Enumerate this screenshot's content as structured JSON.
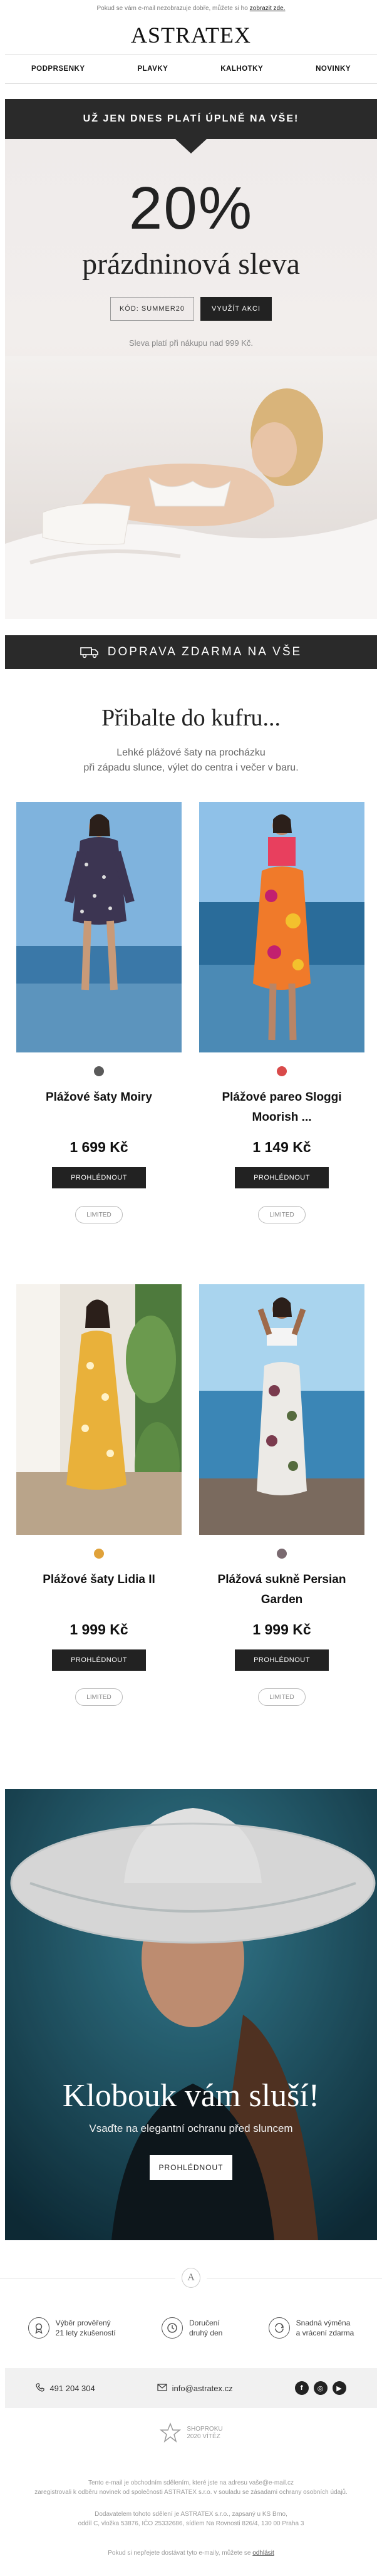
{
  "preheader": {
    "text": "Pokud se vám e-mail nezobrazuje dobře, můžete si ho",
    "link": "zobrazit zde."
  },
  "brand": {
    "logo": "ASTRATEX"
  },
  "nav": {
    "items": [
      "PODPRSENKY",
      "PLAVKY",
      "KALHOTKY",
      "NOVINKY"
    ]
  },
  "hero": {
    "bar": "UŽ JEN DNES PLATÍ ÚPLNĚ NA VŠE!",
    "percent": "20%",
    "subtitle": "prázdninová sleva",
    "code": "KÓD: SUMMER20",
    "cta": "VYUŽÍT AKCI",
    "note": "Sleva platí při nákupu nad 999 Kč."
  },
  "shipping": {
    "text": "DOPRAVA ZDARMA NA VŠE",
    "icon": "truck-icon"
  },
  "section": {
    "title": "Přibalte do kufru...",
    "line1": "Lehké plážové šaty na procházku",
    "line2": "při západu slunce, výlet do centra i večer v baru."
  },
  "products": [
    {
      "name": "Plážové šaty Moiry",
      "price": "1 699 Kč",
      "button": "PROHLÉDNOUT",
      "badge": "LIMITED",
      "dot_color": "#5a5a5a"
    },
    {
      "name": "Plážové pareo Sloggi Moorish ...",
      "price": "1 149 Kč",
      "button": "PROHLÉDNOUT",
      "badge": "LIMITED",
      "dot_color": "#d94a4a"
    },
    {
      "name": "Plážové šaty Lidia II",
      "price": "1 999 Kč",
      "button": "PROHLÉDNOUT",
      "badge": "LIMITED",
      "dot_color": "#e0a23a"
    },
    {
      "name": "Plážová sukně Persian Garden",
      "price": "1 999 Kč",
      "button": "PROHLÉDNOUT",
      "badge": "LIMITED",
      "dot_color": "#7a6a70"
    }
  ],
  "hat": {
    "title": "Klobouk vám sluší!",
    "subtitle": "Vsaďte na elegantní ochranu před sluncem",
    "button": "PROHLÉDNOUT"
  },
  "seal": {
    "letter": "A"
  },
  "benefits": [
    {
      "line1": "Výběr prověřený",
      "line2": "21 lety zkušeností",
      "icon": "award-icon"
    },
    {
      "line1": "Doručení",
      "line2": "druhý den",
      "icon": "clock-icon"
    },
    {
      "line1": "Snadná výměna",
      "line2": "a vrácení zdarma",
      "icon": "return-icon"
    }
  ],
  "contact": {
    "phone": "491 204 304",
    "email": "info@astratex.cz",
    "social": [
      "f",
      "◎",
      "▶"
    ]
  },
  "award": {
    "line1": "SHOPROKU",
    "line2": "2020 VÍTĚZ"
  },
  "footer": {
    "line1": "Tento e-mail je obchodním sdělením, které jste na adresu vaše@e-mail.cz",
    "line2": "zaregistrovali k odběru novinek od společnosti ASTRATEX s.r.o. v souladu se zásadami ochrany osobních údajů.",
    "line3": "Dodavatelem tohoto sdělení je ASTRATEX s.r.o., zapsaný u KS Brno,",
    "line4": "oddíl C, vložka 53876, IČO 25332686, sídlem Na Rovnosti 826/4, 130 00 Praha 3",
    "line5": "Pokud si nepřejete dostávat tyto e-maily, můžete se",
    "unsub": "odhlásit"
  },
  "colors": {
    "dark": "#2a2a2a",
    "accent": "#222222"
  }
}
